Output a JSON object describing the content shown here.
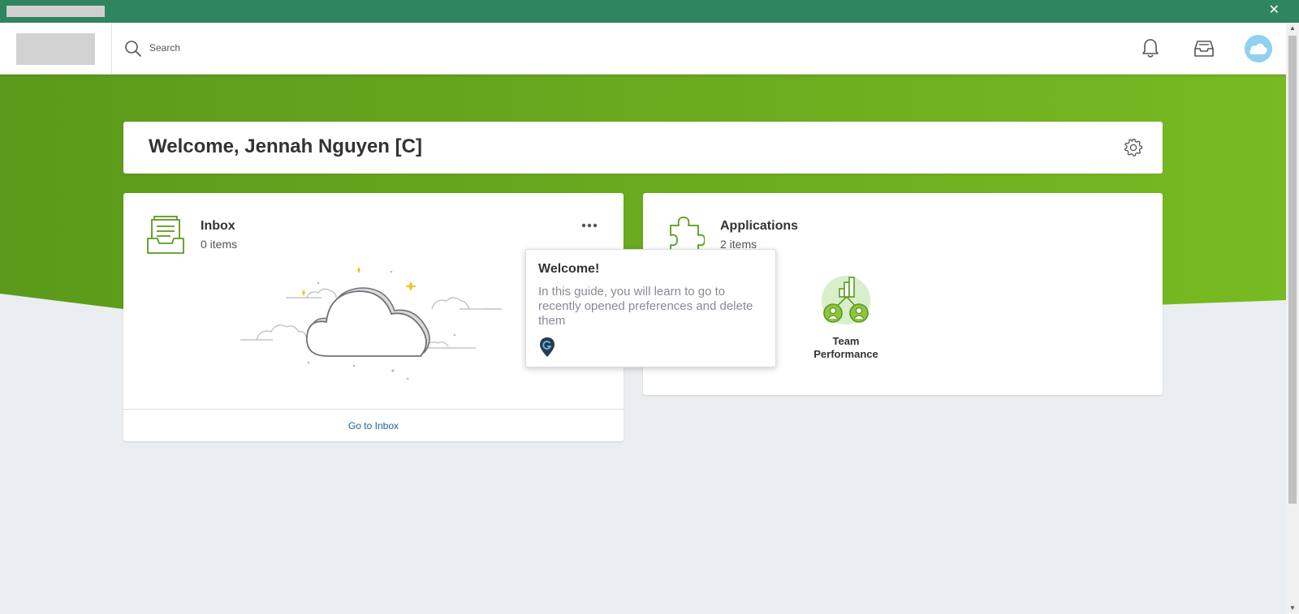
{
  "window": {
    "close_label": "✕"
  },
  "header": {
    "search_placeholder": "Search"
  },
  "welcome": {
    "title": "Welcome, Jennah Nguyen [C]"
  },
  "inbox": {
    "title": "Inbox",
    "count": "0 items",
    "footer_link": "Go to Inbox"
  },
  "applications": {
    "title": "Applications",
    "count": "2 items",
    "apps": [
      {
        "label_line1": "Team",
        "label_line2": "Performance"
      }
    ]
  },
  "guide_tooltip": {
    "title": "Welcome!",
    "body": "In this guide, you will learn to go to recently opened preferences and delete them"
  },
  "colors": {
    "top_bar": "#2f8560",
    "hero_green": "#62a51c",
    "accent_link": "#1a6497",
    "avatar": "#8fd1ef"
  },
  "icons": [
    "close-icon",
    "search-icon",
    "bell-icon",
    "inbox-tray-icon",
    "cloud-avatar-icon",
    "gear-icon",
    "inbox-stack-icon",
    "more-dots-icon",
    "puzzle-icon",
    "team-performance-icon",
    "guide-pin-icon"
  ]
}
